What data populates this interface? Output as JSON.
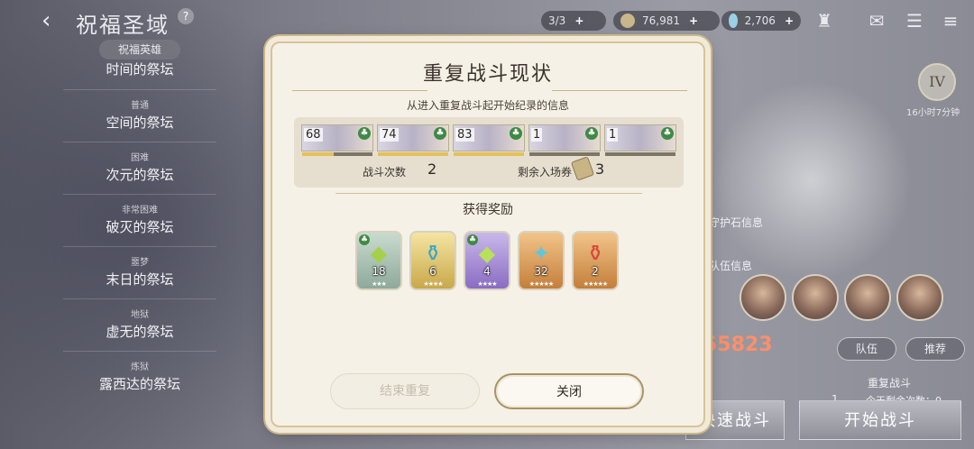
{
  "header": {
    "title": "祝福圣域",
    "stamina": "3/3",
    "gold": "76,981",
    "gems": "2,706"
  },
  "sidebar": {
    "badge": "祝福英雄",
    "items": [
      {
        "sub": "",
        "label": "时间的祭坛"
      },
      {
        "sub": "普通",
        "label": "空间的祭坛"
      },
      {
        "sub": "困难",
        "label": "次元的祭坛"
      },
      {
        "sub": "非常困难",
        "label": "破灭的祭坛"
      },
      {
        "sub": "噩梦",
        "label": "末日的祭坛"
      },
      {
        "sub": "地狱",
        "label": "虚无的祭坛"
      },
      {
        "sub": "炼狱",
        "label": "露西达的祭坛"
      }
    ]
  },
  "right_panel": {
    "rank": "IV",
    "timer": "16小时7分钟",
    "guardian_info": "守护石信息",
    "team_info": "队伍信息",
    "power": "55823",
    "team_button": "队伍",
    "recommend_button": "推荐",
    "repeat_battle": "重复战斗",
    "repeat_count": "1",
    "remaining_today": "今天剩余次数：0",
    "quick_battle": "快速战斗",
    "start_battle": "开始战斗"
  },
  "dialog": {
    "title": "重复战斗现状",
    "subtitle": "从进入重复战斗起开始纪录的信息",
    "heroes": [
      {
        "level": "68",
        "exp_fill": 0.45
      },
      {
        "level": "74",
        "exp_fill": 1.0
      },
      {
        "level": "83",
        "exp_fill": 1.0
      },
      {
        "level": "1",
        "exp_fill": 0.0
      },
      {
        "level": "1",
        "exp_fill": 0.0
      }
    ],
    "battle_count_label": "战斗次数",
    "battle_count": "2",
    "tickets_label": "剩余入场券",
    "tickets": "3",
    "rewards_title": "获得奖励",
    "rewards": [
      {
        "count": "18",
        "icon": "green-crystal-icon",
        "glyph": "◆",
        "color": "#a6d04a",
        "tier": "green"
      },
      {
        "count": "6",
        "icon": "potion-bottle-icon",
        "glyph": "⚱",
        "color": "#3aa6c8",
        "tier": "gold"
      },
      {
        "count": "4",
        "icon": "green-gem-icon",
        "glyph": "◆",
        "color": "#b9e05a",
        "tier": "purple"
      },
      {
        "count": "32",
        "icon": "star-emblem-icon",
        "glyph": "✦",
        "color": "#5fc7d8",
        "tier": "orange"
      },
      {
        "count": "2",
        "icon": "red-potion-icon",
        "glyph": "⚱",
        "color": "#d8463a",
        "tier": "orange"
      }
    ],
    "end_button": "结束重复",
    "close_button": "关闭"
  }
}
